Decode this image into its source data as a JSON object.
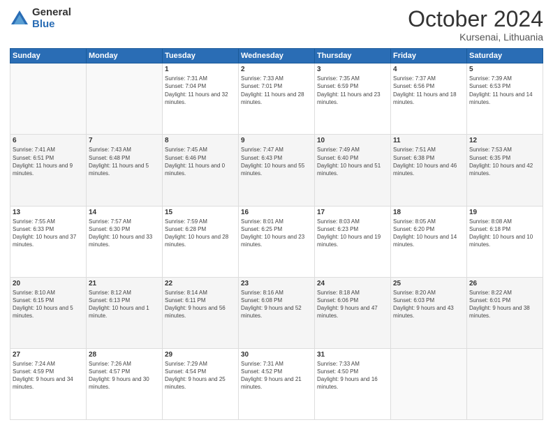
{
  "logo": {
    "general": "General",
    "blue": "Blue"
  },
  "title": "October 2024",
  "location": "Kursenai, Lithuania",
  "weekdays": [
    "Sunday",
    "Monday",
    "Tuesday",
    "Wednesday",
    "Thursday",
    "Friday",
    "Saturday"
  ],
  "weeks": [
    [
      {
        "day": "",
        "info": ""
      },
      {
        "day": "",
        "info": ""
      },
      {
        "day": "1",
        "info": "Sunrise: 7:31 AM\nSunset: 7:04 PM\nDaylight: 11 hours and 32 minutes."
      },
      {
        "day": "2",
        "info": "Sunrise: 7:33 AM\nSunset: 7:01 PM\nDaylight: 11 hours and 28 minutes."
      },
      {
        "day": "3",
        "info": "Sunrise: 7:35 AM\nSunset: 6:59 PM\nDaylight: 11 hours and 23 minutes."
      },
      {
        "day": "4",
        "info": "Sunrise: 7:37 AM\nSunset: 6:56 PM\nDaylight: 11 hours and 18 minutes."
      },
      {
        "day": "5",
        "info": "Sunrise: 7:39 AM\nSunset: 6:53 PM\nDaylight: 11 hours and 14 minutes."
      }
    ],
    [
      {
        "day": "6",
        "info": "Sunrise: 7:41 AM\nSunset: 6:51 PM\nDaylight: 11 hours and 9 minutes."
      },
      {
        "day": "7",
        "info": "Sunrise: 7:43 AM\nSunset: 6:48 PM\nDaylight: 11 hours and 5 minutes."
      },
      {
        "day": "8",
        "info": "Sunrise: 7:45 AM\nSunset: 6:46 PM\nDaylight: 11 hours and 0 minutes."
      },
      {
        "day": "9",
        "info": "Sunrise: 7:47 AM\nSunset: 6:43 PM\nDaylight: 10 hours and 55 minutes."
      },
      {
        "day": "10",
        "info": "Sunrise: 7:49 AM\nSunset: 6:40 PM\nDaylight: 10 hours and 51 minutes."
      },
      {
        "day": "11",
        "info": "Sunrise: 7:51 AM\nSunset: 6:38 PM\nDaylight: 10 hours and 46 minutes."
      },
      {
        "day": "12",
        "info": "Sunrise: 7:53 AM\nSunset: 6:35 PM\nDaylight: 10 hours and 42 minutes."
      }
    ],
    [
      {
        "day": "13",
        "info": "Sunrise: 7:55 AM\nSunset: 6:33 PM\nDaylight: 10 hours and 37 minutes."
      },
      {
        "day": "14",
        "info": "Sunrise: 7:57 AM\nSunset: 6:30 PM\nDaylight: 10 hours and 33 minutes."
      },
      {
        "day": "15",
        "info": "Sunrise: 7:59 AM\nSunset: 6:28 PM\nDaylight: 10 hours and 28 minutes."
      },
      {
        "day": "16",
        "info": "Sunrise: 8:01 AM\nSunset: 6:25 PM\nDaylight: 10 hours and 23 minutes."
      },
      {
        "day": "17",
        "info": "Sunrise: 8:03 AM\nSunset: 6:23 PM\nDaylight: 10 hours and 19 minutes."
      },
      {
        "day": "18",
        "info": "Sunrise: 8:05 AM\nSunset: 6:20 PM\nDaylight: 10 hours and 14 minutes."
      },
      {
        "day": "19",
        "info": "Sunrise: 8:08 AM\nSunset: 6:18 PM\nDaylight: 10 hours and 10 minutes."
      }
    ],
    [
      {
        "day": "20",
        "info": "Sunrise: 8:10 AM\nSunset: 6:15 PM\nDaylight: 10 hours and 5 minutes."
      },
      {
        "day": "21",
        "info": "Sunrise: 8:12 AM\nSunset: 6:13 PM\nDaylight: 10 hours and 1 minute."
      },
      {
        "day": "22",
        "info": "Sunrise: 8:14 AM\nSunset: 6:11 PM\nDaylight: 9 hours and 56 minutes."
      },
      {
        "day": "23",
        "info": "Sunrise: 8:16 AM\nSunset: 6:08 PM\nDaylight: 9 hours and 52 minutes."
      },
      {
        "day": "24",
        "info": "Sunrise: 8:18 AM\nSunset: 6:06 PM\nDaylight: 9 hours and 47 minutes."
      },
      {
        "day": "25",
        "info": "Sunrise: 8:20 AM\nSunset: 6:03 PM\nDaylight: 9 hours and 43 minutes."
      },
      {
        "day": "26",
        "info": "Sunrise: 8:22 AM\nSunset: 6:01 PM\nDaylight: 9 hours and 38 minutes."
      }
    ],
    [
      {
        "day": "27",
        "info": "Sunrise: 7:24 AM\nSunset: 4:59 PM\nDaylight: 9 hours and 34 minutes."
      },
      {
        "day": "28",
        "info": "Sunrise: 7:26 AM\nSunset: 4:57 PM\nDaylight: 9 hours and 30 minutes."
      },
      {
        "day": "29",
        "info": "Sunrise: 7:29 AM\nSunset: 4:54 PM\nDaylight: 9 hours and 25 minutes."
      },
      {
        "day": "30",
        "info": "Sunrise: 7:31 AM\nSunset: 4:52 PM\nDaylight: 9 hours and 21 minutes."
      },
      {
        "day": "31",
        "info": "Sunrise: 7:33 AM\nSunset: 4:50 PM\nDaylight: 9 hours and 16 minutes."
      },
      {
        "day": "",
        "info": ""
      },
      {
        "day": "",
        "info": ""
      }
    ]
  ]
}
